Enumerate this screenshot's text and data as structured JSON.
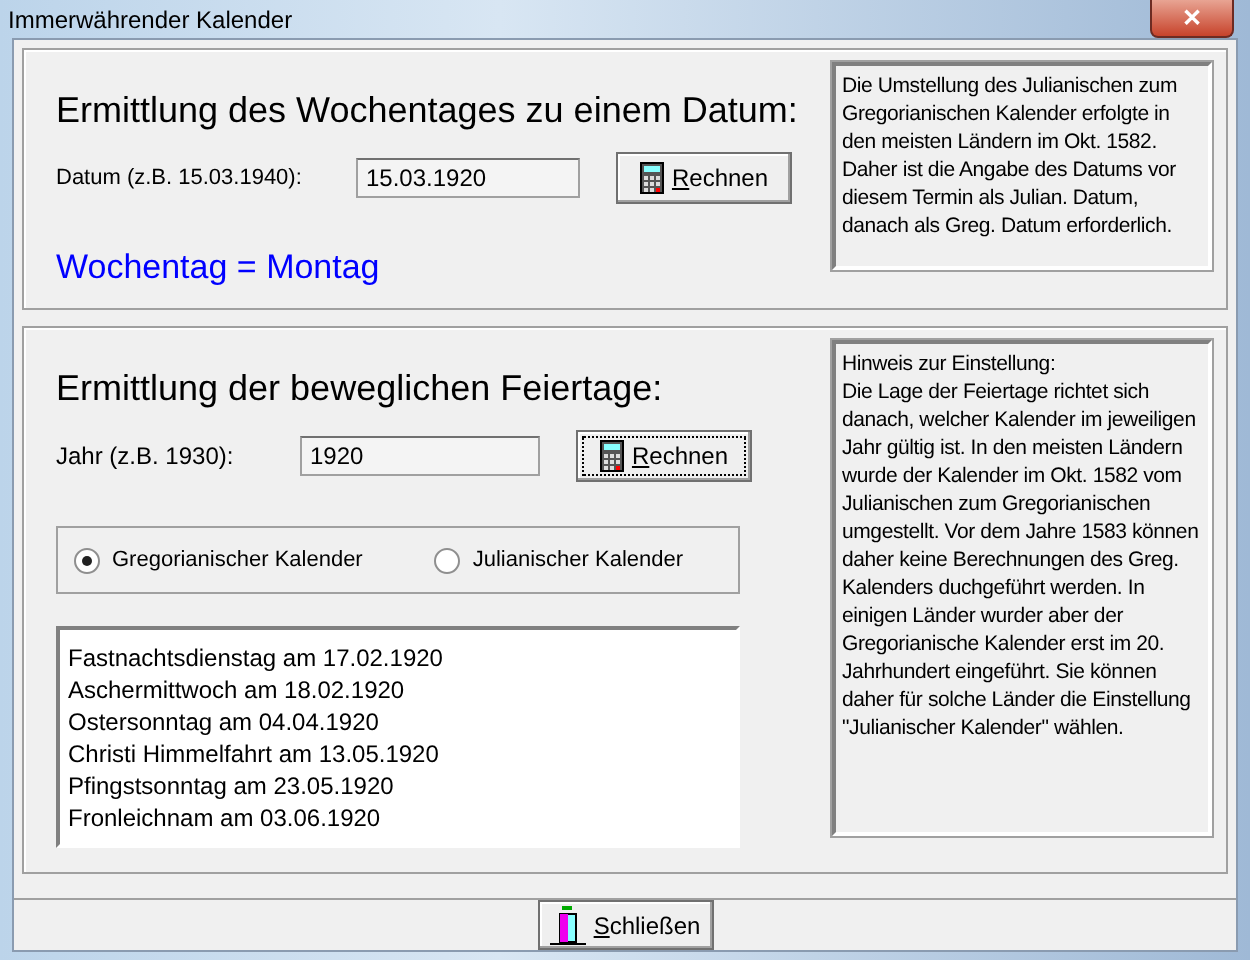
{
  "window": {
    "title": "Immerwährender Kalender",
    "close": "✕"
  },
  "weekday": {
    "heading": "Ermittlung des Wochentages zu einem Datum:",
    "label": "Datum (z.B. 15.03.1940):",
    "value": "15.03.1920",
    "button": "Rechnen",
    "result": "Wochentag = Montag",
    "note": "Die Umstellung des Julianischen zum Gregorianischen Kalender erfolgte in den meisten Ländern im Okt. 1582. Daher ist die Angabe des Datums vor diesem Termin als Julian. Datum, danach als Greg. Datum erforderlich."
  },
  "holidays": {
    "heading": "Ermittlung der beweglichen Feiertage:",
    "label": "Jahr (z.B. 1930):",
    "value": "1920",
    "button": "Rechnen",
    "calendars": [
      {
        "label": "Gregorianischer Kalender",
        "selected": true
      },
      {
        "label": "Julianischer Kalender",
        "selected": false
      }
    ],
    "results": [
      "Fastnachtsdienstag am 17.02.1920",
      "Aschermittwoch am 18.02.1920",
      "Ostersonntag am 04.04.1920",
      "Christi Himmelfahrt am 13.05.1920",
      "Pfingstsonntag am 23.05.1920",
      "Fronleichnam am 03.06.1920"
    ],
    "note_title": "Hinweis zur Einstellung:",
    "note": "Die Lage der Feiertage richtet sich danach, welcher Kalender im jeweiligen Jahr gültig ist. In den meisten Ländern wurde der Kalender im Okt. 1582 vom Julianischen zum Gregorianischen umgestellt. Vor dem Jahre 1583 können daher keine Berechnungen des Greg. Kalenders duchgeführt werden. In einigen Länder wurder aber der Gregorianische Kalender erst im 20. Jahrhundert eingeführt. Sie können daher für solche Länder die Einstellung \"Julianischer Kalender\" wählen."
  },
  "close_button": "Schließen"
}
